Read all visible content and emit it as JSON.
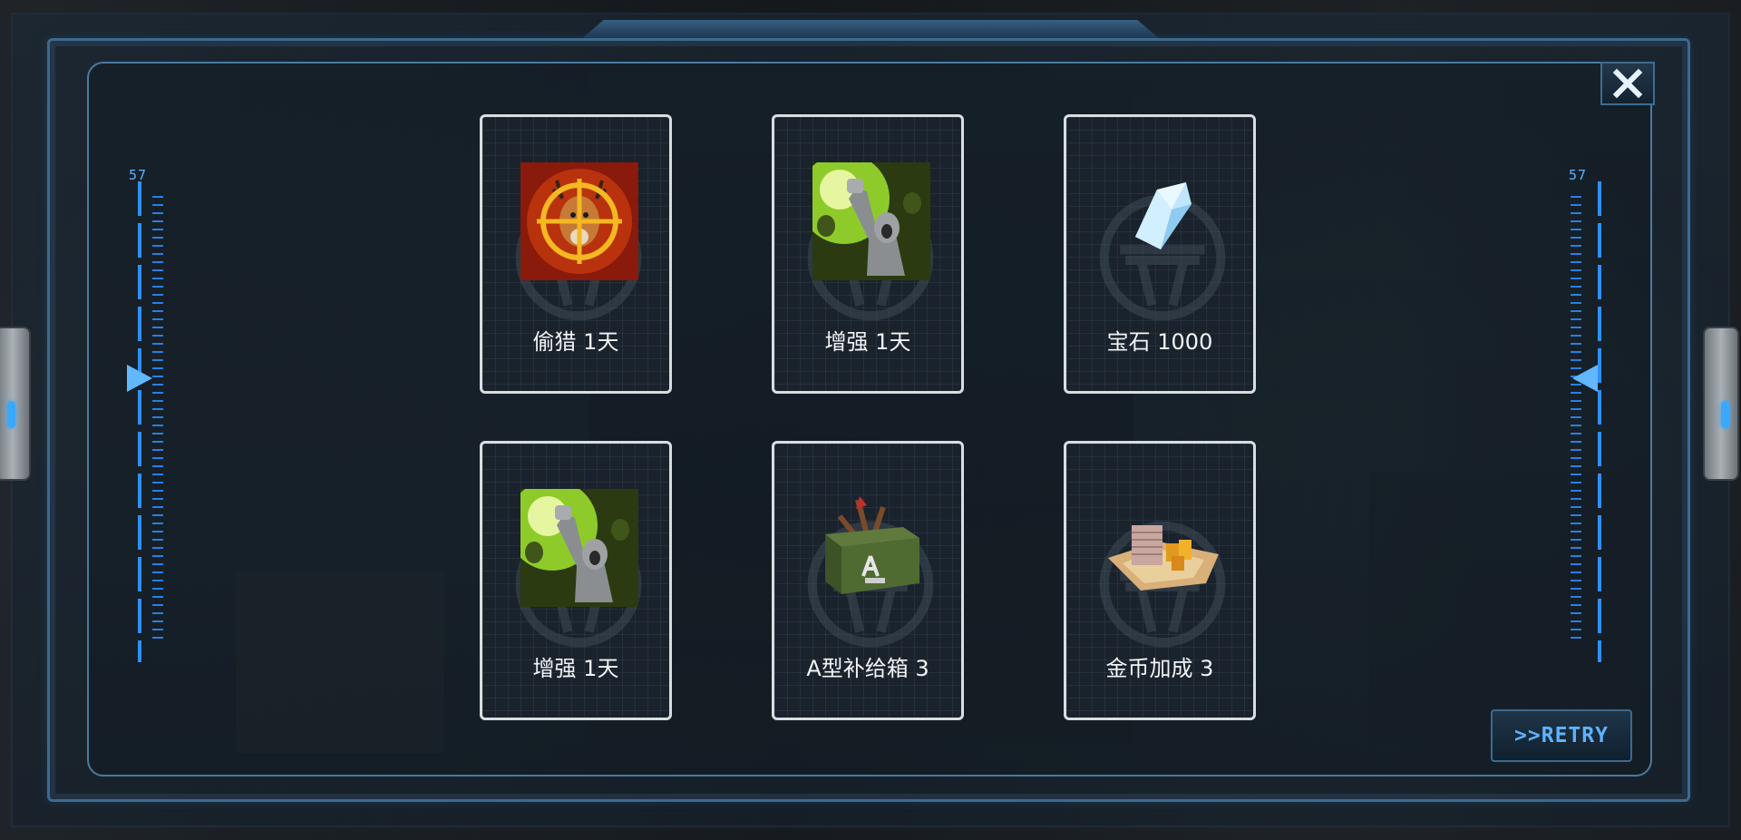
{
  "gauges": {
    "left_value": "57",
    "right_value": "57"
  },
  "rewards": [
    {
      "label": "偷猎 1天",
      "icon": "poaching-deer-crosshair-icon"
    },
    {
      "label": "增强 1天",
      "icon": "boost-raised-fist-icon"
    },
    {
      "label": "宝石 1000",
      "icon": "gem-crystal-icon"
    },
    {
      "label": "增强 1天",
      "icon": "boost-raised-fist-icon"
    },
    {
      "label": "A型补给箱 3",
      "icon": "supply-crate-a-icon"
    },
    {
      "label": "金币加成 3",
      "icon": "gold-bonus-cash-icon"
    }
  ],
  "buttons": {
    "retry_label": ">>RETRY",
    "close_icon": "close-icon"
  },
  "colors": {
    "accent": "#5fb2ff",
    "card_border": "#d9dde0",
    "frame": "#3d6a8e"
  }
}
